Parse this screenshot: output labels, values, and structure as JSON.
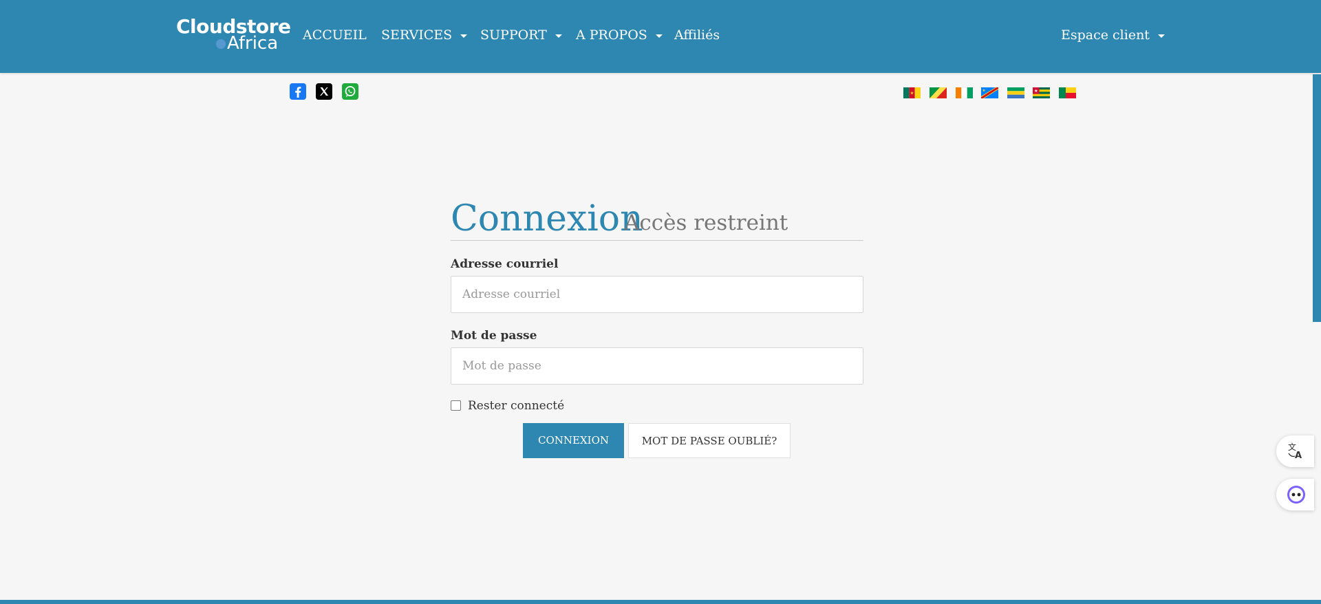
{
  "brand": {
    "line1": "Cloudstore",
    "line2": "Africa"
  },
  "nav": {
    "items": [
      {
        "label": "ACCUEIL"
      },
      {
        "label": "SERVICES"
      },
      {
        "label": "SUPPORT"
      },
      {
        "label": "A PROPOS"
      },
      {
        "label": "Affiliés"
      }
    ],
    "account": "Espace client"
  },
  "social": [
    "facebook-icon",
    "x-icon",
    "whatsapp-icon"
  ],
  "flags": [
    "cameroon-flag",
    "congo-flag",
    "ivory-coast-flag",
    "drc-flag",
    "gabon-flag",
    "togo-flag",
    "benin-flag"
  ],
  "login": {
    "title": "Connexion",
    "subtitle": "Accès restreint",
    "email_label": "Adresse courriel",
    "email_placeholder": "Adresse courriel",
    "email_value": "",
    "password_label": "Mot de passe",
    "password_placeholder": "Mot de passe",
    "password_value": "",
    "remember_label": "Rester connecté",
    "remember_checked": false,
    "submit_label": "CONNEXION",
    "forgot_label": "MOT DE PASSE OUBLIÉ?"
  },
  "widgets": [
    "translate-icon",
    "assistant-icon"
  ],
  "colors": {
    "primary": "#2d87b1",
    "background": "#f6f6f6"
  }
}
